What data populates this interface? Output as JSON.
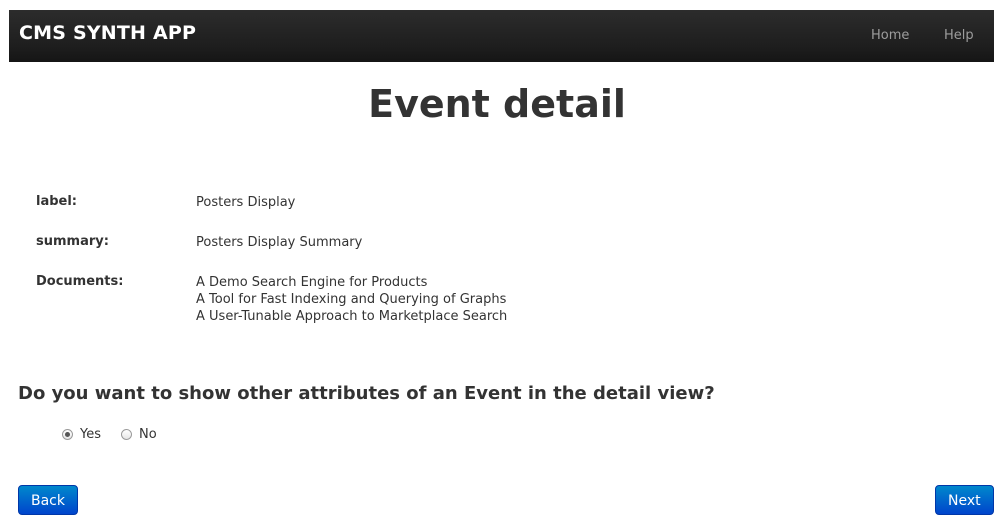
{
  "navbar": {
    "brand": "CMS SYNTH APP",
    "links": [
      "Home",
      "Help"
    ]
  },
  "page": {
    "title": "Event detail"
  },
  "details": {
    "label": {
      "key": "label:",
      "value": "Posters Display"
    },
    "summary": {
      "key": "summary:",
      "value": "Posters Display Summary"
    },
    "documents": {
      "key": "Documents:",
      "items": [
        "A Demo Search Engine for Products",
        "A Tool for Fast Indexing and Querying of Graphs",
        "A User-Tunable Approach to Marketplace Search"
      ]
    }
  },
  "question": {
    "text": "Do you want to show other attributes of an Event in the detail view?",
    "options": [
      "Yes",
      "No"
    ],
    "selected": "Yes"
  },
  "buttons": {
    "back": "Back",
    "next": "Next"
  },
  "colors": {
    "navbar": "#222222",
    "button_primary": "#0055cc",
    "text": "#333333"
  }
}
